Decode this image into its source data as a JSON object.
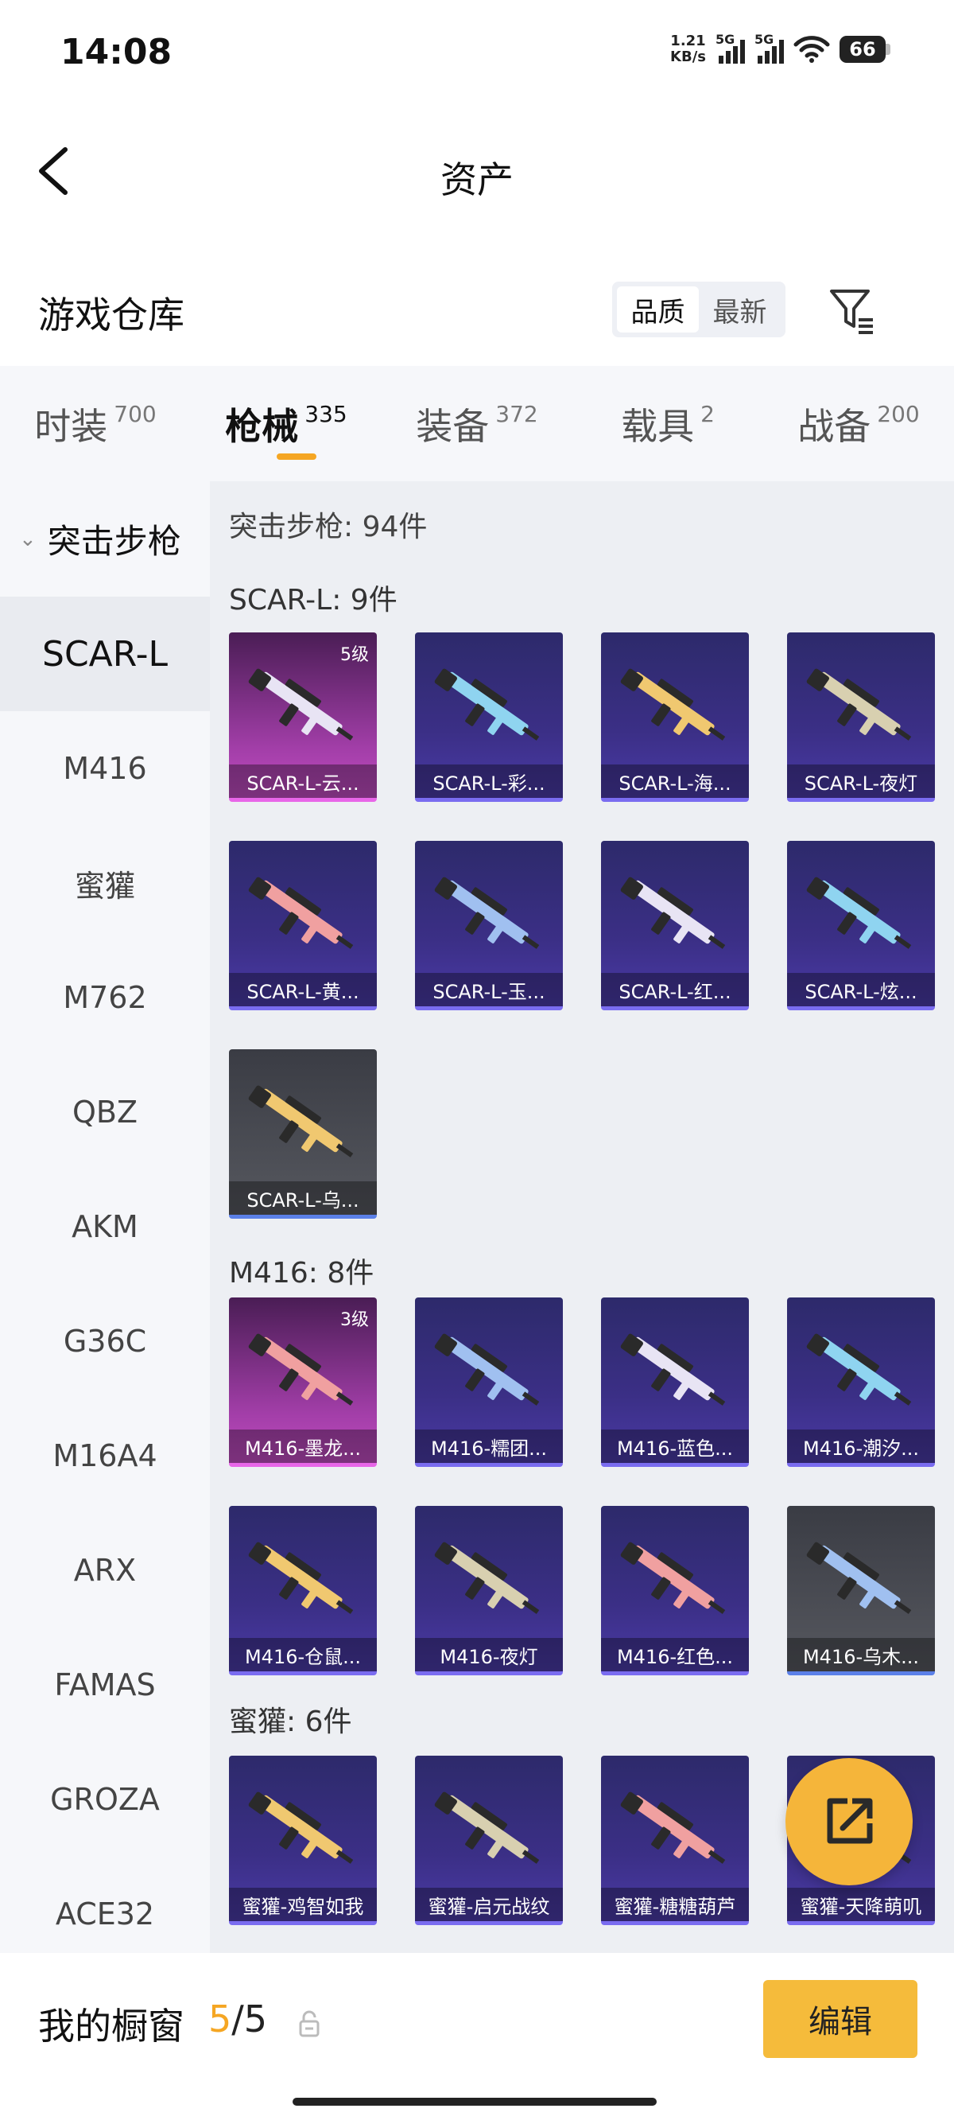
{
  "status_bar": {
    "time": "14:08",
    "net_speed_value": "1.21",
    "net_speed_unit": "KB/s",
    "sim1": "5G",
    "sim2": "5G",
    "battery": "66"
  },
  "header": {
    "title": "资产"
  },
  "warehouse": {
    "title": "游戏仓库",
    "sort_options": [
      "品质",
      "最新"
    ],
    "active_sort": "品质"
  },
  "tabs": [
    {
      "label": "时装",
      "count": "700"
    },
    {
      "label": "枪械",
      "count": "335",
      "active": true
    },
    {
      "label": "装备",
      "count": "372"
    },
    {
      "label": "载具",
      "count": "2"
    },
    {
      "label": "战备",
      "count": "200"
    }
  ],
  "sidebar": {
    "category": "突击步枪",
    "items": [
      "SCAR-L",
      "M416",
      "蜜獾",
      "M762",
      "QBZ",
      "AKM",
      "G36C",
      "M16A4",
      "ARX",
      "FAMAS",
      "GROZA",
      "ACE32"
    ],
    "active": "SCAR-L"
  },
  "main": {
    "total_label": "突击步枪: 94件",
    "groups": [
      {
        "label": "SCAR-L: 9件",
        "items": [
          {
            "name": "SCAR-L-云...",
            "level": "5级",
            "rarity": "pink"
          },
          {
            "name": "SCAR-L-彩...",
            "rarity": "purple"
          },
          {
            "name": "SCAR-L-海...",
            "rarity": "purple"
          },
          {
            "name": "SCAR-L-夜灯",
            "rarity": "purple"
          },
          {
            "name": "SCAR-L-黄...",
            "rarity": "purple"
          },
          {
            "name": "SCAR-L-玉...",
            "rarity": "purple"
          },
          {
            "name": "SCAR-L-红...",
            "rarity": "purple"
          },
          {
            "name": "SCAR-L-炫...",
            "rarity": "purple"
          },
          {
            "name": "SCAR-L-乌...",
            "rarity": "grey"
          }
        ]
      },
      {
        "label": "M416: 8件",
        "items": [
          {
            "name": "M416-墨龙...",
            "level": "3级",
            "rarity": "pink"
          },
          {
            "name": "M416-糯团...",
            "rarity": "purple"
          },
          {
            "name": "M416-蓝色...",
            "rarity": "purple"
          },
          {
            "name": "M416-潮汐...",
            "rarity": "purple"
          },
          {
            "name": "M416-仓鼠...",
            "rarity": "purple"
          },
          {
            "name": "M416-夜灯",
            "rarity": "purple"
          },
          {
            "name": "M416-红色...",
            "rarity": "purple"
          },
          {
            "name": "M416-乌木...",
            "rarity": "grey"
          }
        ]
      },
      {
        "label": "蜜獾: 6件",
        "items": [
          {
            "name": "蜜獾-鸡智如我",
            "rarity": "purple"
          },
          {
            "name": "蜜獾-启元战纹",
            "rarity": "purple"
          },
          {
            "name": "蜜獾-糖糖葫芦",
            "rarity": "purple"
          },
          {
            "name": "蜜獾-天降萌叽",
            "rarity": "purple"
          }
        ]
      }
    ]
  },
  "bottom_bar": {
    "showcase_label": "我的橱窗",
    "showcase_current": "5",
    "showcase_total": "/5",
    "edit_label": "编辑"
  },
  "colors": {
    "accent": "#f5a623",
    "button": "#f5bb3b",
    "pink_rarity": "#c04cc0",
    "purple_rarity": "#4a3aa6",
    "grey_rarity": "#56585f"
  }
}
